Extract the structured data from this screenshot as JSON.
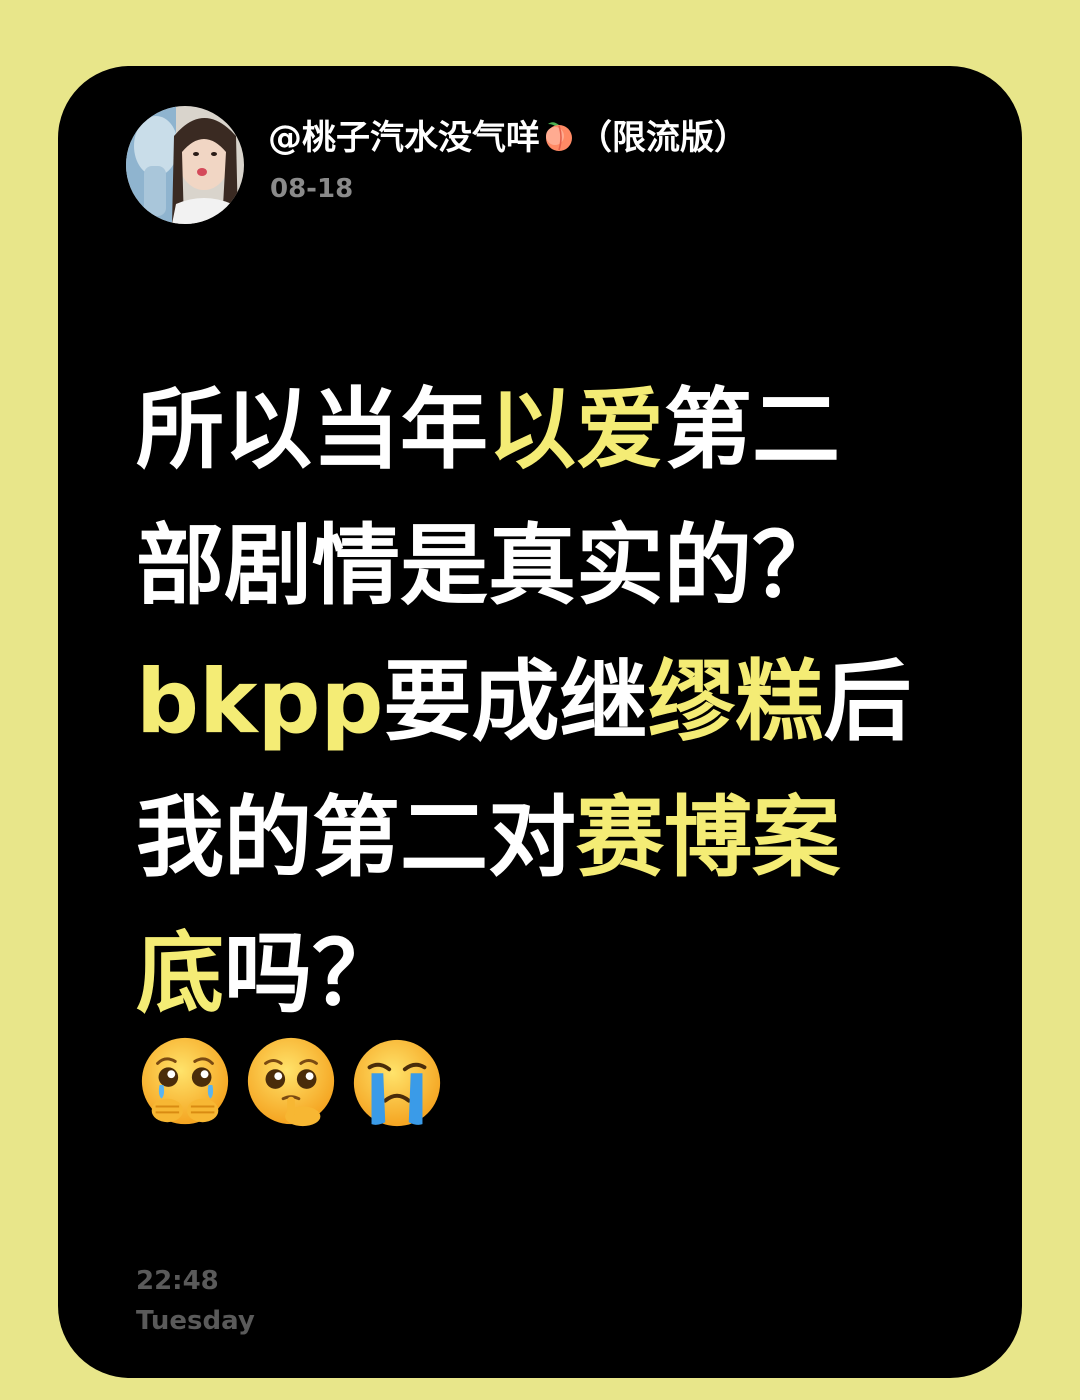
{
  "header": {
    "username": "@桃子汽水没气咩",
    "username_suffix": "（限流版）",
    "username_icon": "peach-icon",
    "date": "08-18"
  },
  "post": {
    "lines": [
      [
        {
          "text": "所以当年",
          "highlight": false
        },
        {
          "text": "以爱",
          "highlight": true
        },
        {
          "text": "第二",
          "highlight": false
        }
      ],
      [
        {
          "text": "部剧情是真实的？",
          "highlight": false
        }
      ],
      [
        {
          "text": "bkpp",
          "highlight": true
        },
        {
          "text": "要成继",
          "highlight": false
        },
        {
          "text": "缪糕",
          "highlight": true
        },
        {
          "text": "后",
          "highlight": false
        }
      ],
      [
        {
          "text": "我的第二对",
          "highlight": false
        },
        {
          "text": "赛博案",
          "highlight": true
        }
      ],
      [
        {
          "text": "底",
          "highlight": true
        },
        {
          "text": "吗？",
          "highlight": false
        }
      ]
    ],
    "emojis": [
      "pleading-face-hands-over-mouth-icon",
      "pleading-face-thinking-icon",
      "loudly-crying-face-icon"
    ]
  },
  "footer": {
    "time": "22:48",
    "day": "Tuesday"
  },
  "colors": {
    "background": "#e8e68a",
    "card": "#000000",
    "highlight": "#f4ec75",
    "text": "#ffffff",
    "muted": "#8a8a8a"
  }
}
